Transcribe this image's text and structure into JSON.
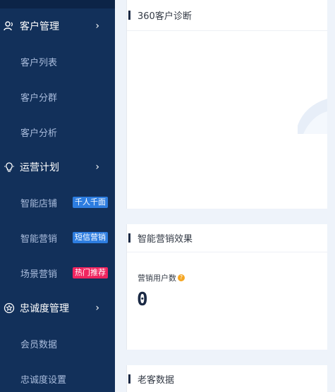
{
  "colors": {
    "sidebar_bg": "#12305a",
    "main_bg": "#eef3fa",
    "badge_blue": "#2d7de0",
    "badge_pink": "#f0245f"
  },
  "sidebar": {
    "groups": [
      {
        "label": "客户管理",
        "icon": "users-icon",
        "items": [
          {
            "label": "客户列表"
          },
          {
            "label": "客户分群"
          },
          {
            "label": "客户分析"
          }
        ]
      },
      {
        "label": "运营计划",
        "icon": "bulb-icon",
        "items": [
          {
            "label": "智能店铺",
            "badge": "千人千面"
          },
          {
            "label": "智能营销",
            "badge": "短信营销"
          },
          {
            "label": "场景营销",
            "badge": "热门推荐"
          }
        ]
      },
      {
        "label": "忠诚度管理",
        "icon": "star-badge-icon",
        "items": [
          {
            "label": "会员数据"
          },
          {
            "label": "忠诚度设置"
          }
        ]
      }
    ]
  },
  "main": {
    "panels": [
      {
        "title": "360客户诊断"
      },
      {
        "title": "智能营销效果",
        "stat_label": "营销用户数",
        "stat_value": "0"
      },
      {
        "title": "老客数据"
      }
    ]
  }
}
